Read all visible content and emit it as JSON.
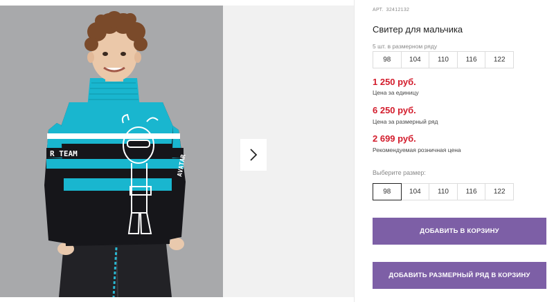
{
  "product": {
    "article_label": "АРТ.",
    "article_number": "32412132",
    "title": "Свитер для мальчика"
  },
  "pack": {
    "label": "5 шт. в размерном ряду",
    "sizes": [
      "98",
      "104",
      "110",
      "116",
      "122"
    ]
  },
  "prices": {
    "unit_price": "1 250 руб.",
    "unit_label": "Цена за единицу",
    "pack_price": "6 250 руб.",
    "pack_label": "Цена за размерный ряд",
    "retail_price": "2 699 руб.",
    "retail_label": "Рекомендуемая розничная цена"
  },
  "size_select": {
    "label": "Выберите размер:",
    "sizes": [
      "98",
      "104",
      "110",
      "116",
      "122"
    ],
    "selected": "98"
  },
  "buttons": {
    "add_to_cart": "Добавить в корзину",
    "add_pack_to_cart": "Добавить размерный ряд в корзину"
  },
  "photo": {
    "sweater_text_left": "R TEAM",
    "sweater_text_sleeve": "AVATAR"
  },
  "colors": {
    "accent_purple": "#7d5fa6",
    "price_red": "#d31c2c",
    "sweater_cyan": "#19b6cf",
    "sweater_black": "#16161a"
  }
}
